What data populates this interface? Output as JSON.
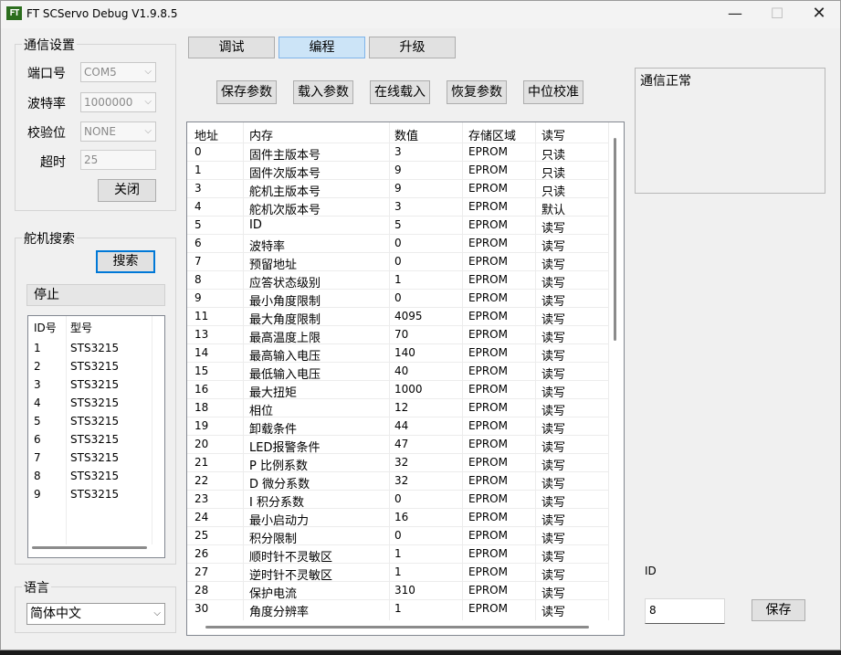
{
  "window": {
    "title": "FT SCServo Debug V1.9.8.5",
    "icon_text": "FT",
    "icons": [
      "minimize-icon",
      "maximize-icon",
      "close-icon"
    ]
  },
  "tabs": [
    "调试",
    "编程",
    "升级"
  ],
  "comm": {
    "title": "通信设置",
    "port_label": "端口号",
    "port_value": "COM5",
    "baud_label": "波特率",
    "baud_value": "1000000",
    "parity_label": "校验位",
    "parity_value": "NONE",
    "timeout_label": "超时",
    "timeout_value": "25",
    "close_button": "关闭"
  },
  "search": {
    "title": "舵机搜索",
    "search_button": "搜索",
    "stop_button": "停止",
    "columns": [
      "ID号",
      "型号"
    ],
    "rows": [
      [
        "1",
        "STS3215"
      ],
      [
        "2",
        "STS3215"
      ],
      [
        "3",
        "STS3215"
      ],
      [
        "4",
        "STS3215"
      ],
      [
        "5",
        "STS3215"
      ],
      [
        "6",
        "STS3215"
      ],
      [
        "7",
        "STS3215"
      ],
      [
        "8",
        "STS3215"
      ],
      [
        "9",
        "STS3215"
      ]
    ]
  },
  "language": {
    "title": "语言",
    "value": "简体中文"
  },
  "toolbar": [
    "保存参数",
    "载入参数",
    "在线载入",
    "恢复参数",
    "中位校准"
  ],
  "table": {
    "columns": [
      "地址",
      "内存",
      "数值",
      "存储区域",
      "读写"
    ],
    "rows": [
      [
        "0",
        "固件主版本号",
        "3",
        "EPROM",
        "只读"
      ],
      [
        "1",
        "固件次版本号",
        "9",
        "EPROM",
        "只读"
      ],
      [
        "3",
        "舵机主版本号",
        "9",
        "EPROM",
        "只读"
      ],
      [
        "4",
        "舵机次版本号",
        "3",
        "EPROM",
        "默认"
      ],
      [
        "5",
        "ID",
        "5",
        "EPROM",
        "读写"
      ],
      [
        "6",
        "波特率",
        "0",
        "EPROM",
        "读写"
      ],
      [
        "7",
        "预留地址",
        "0",
        "EPROM",
        "读写"
      ],
      [
        "8",
        "应答状态级别",
        "1",
        "EPROM",
        "读写"
      ],
      [
        "9",
        "最小角度限制",
        "0",
        "EPROM",
        "读写"
      ],
      [
        "11",
        "最大角度限制",
        "4095",
        "EPROM",
        "读写"
      ],
      [
        "13",
        "最高温度上限",
        "70",
        "EPROM",
        "读写"
      ],
      [
        "14",
        "最高输入电压",
        "140",
        "EPROM",
        "读写"
      ],
      [
        "15",
        "最低输入电压",
        "40",
        "EPROM",
        "读写"
      ],
      [
        "16",
        "最大扭矩",
        "1000",
        "EPROM",
        "读写"
      ],
      [
        "18",
        "相位",
        "12",
        "EPROM",
        "读写"
      ],
      [
        "19",
        "卸载条件",
        "44",
        "EPROM",
        "读写"
      ],
      [
        "20",
        "LED报警条件",
        "47",
        "EPROM",
        "读写"
      ],
      [
        "21",
        "P 比例系数",
        "32",
        "EPROM",
        "读写"
      ],
      [
        "22",
        "D 微分系数",
        "32",
        "EPROM",
        "读写"
      ],
      [
        "23",
        "I 积分系数",
        "0",
        "EPROM",
        "读写"
      ],
      [
        "24",
        "最小启动力",
        "16",
        "EPROM",
        "读写"
      ],
      [
        "25",
        "积分限制",
        "0",
        "EPROM",
        "读写"
      ],
      [
        "26",
        "顺时针不灵敏区",
        "1",
        "EPROM",
        "读写"
      ],
      [
        "27",
        "逆时针不灵敏区",
        "1",
        "EPROM",
        "读写"
      ],
      [
        "28",
        "保护电流",
        "310",
        "EPROM",
        "读写"
      ],
      [
        "30",
        "角度分辨率",
        "1",
        "EPROM",
        "读写"
      ]
    ]
  },
  "status": {
    "text": "通信正常"
  },
  "edit": {
    "id_label": "ID",
    "id_value": "8",
    "save_button": "保存"
  }
}
